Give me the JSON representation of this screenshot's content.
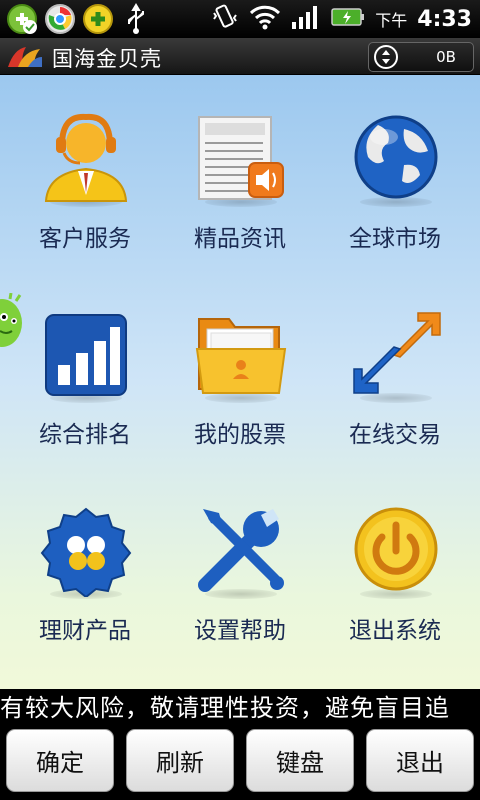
{
  "status_bar": {
    "ampm": "下午",
    "time": "4:33",
    "notification_icons": [
      "app-add-check-icon",
      "browser-icon",
      "app-add-icon",
      "usb-icon"
    ],
    "system_icons": [
      "vibrate-icon",
      "wifi-icon",
      "signal-icon",
      "battery-charging-icon"
    ]
  },
  "app_bar": {
    "title": "国海金贝壳",
    "traffic": "0B"
  },
  "menu": [
    {
      "label": "客户服务",
      "icon": "customer-service-icon"
    },
    {
      "label": "精品资讯",
      "icon": "information-news-icon"
    },
    {
      "label": "全球市场",
      "icon": "globe-icon"
    },
    {
      "label": "综合排名",
      "icon": "bar-chart-icon"
    },
    {
      "label": "我的股票",
      "icon": "folder-icon"
    },
    {
      "label": "在线交易",
      "icon": "trade-arrows-icon"
    },
    {
      "label": "理财产品",
      "icon": "wealth-product-icon"
    },
    {
      "label": "设置帮助",
      "icon": "settings-tools-icon"
    },
    {
      "label": "退出系统",
      "icon": "power-icon"
    }
  ],
  "ticker": "有较大风险，敬请理性投资，避免盲目追",
  "buttons": {
    "confirm": "确定",
    "refresh": "刷新",
    "keyboard": "键盘",
    "exit": "退出"
  },
  "colors": {
    "label_text": "#1a2a52",
    "main_bg_top": "#9cc8ef",
    "main_bg_bottom": "#f1f9d9"
  }
}
